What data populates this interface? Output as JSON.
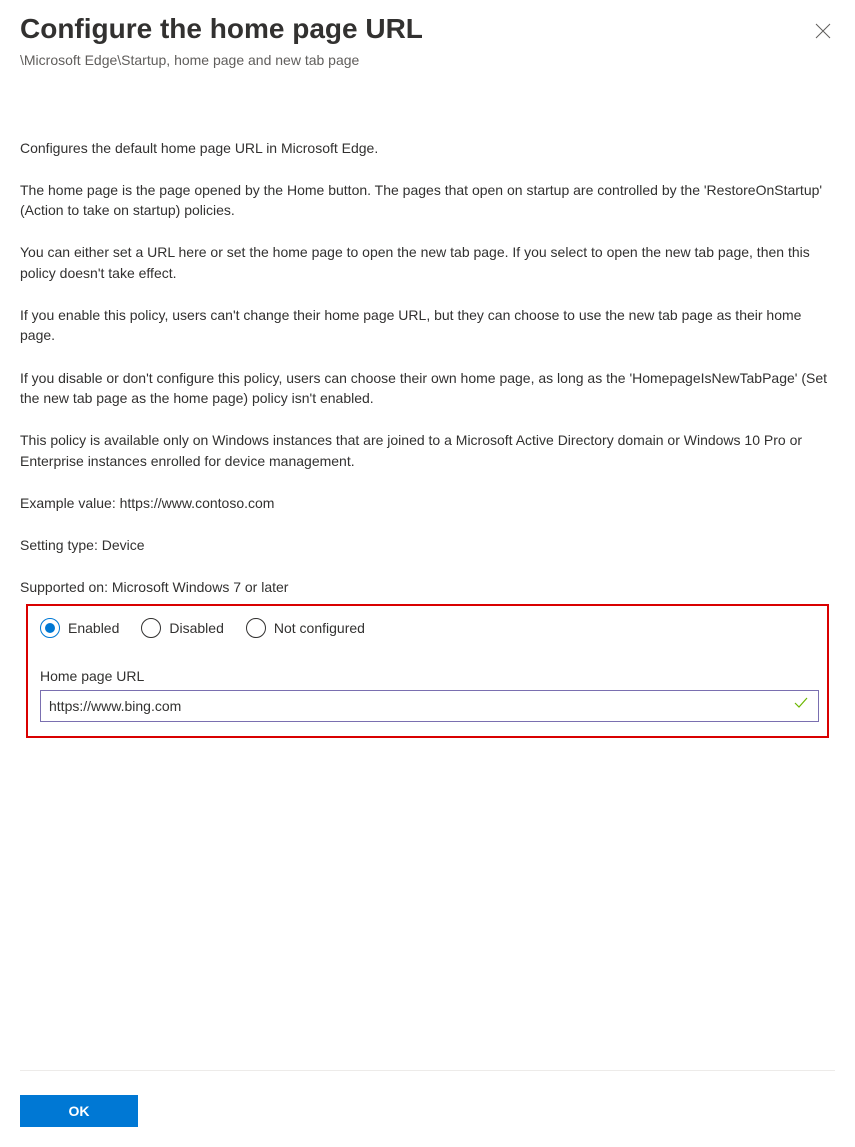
{
  "header": {
    "title": "Configure the home page URL",
    "breadcrumb": "\\Microsoft Edge\\Startup, home page and new tab page"
  },
  "description": {
    "p1": "Configures the default home page URL in Microsoft Edge.",
    "p2": "The home page is the page opened by the Home button. The pages that open on startup are controlled by the 'RestoreOnStartup' (Action to take on startup) policies.",
    "p3": "You can either set a URL here or set the home page to open the new tab page. If you select to open the new tab page, then this policy doesn't take effect.",
    "p4": "If you enable this policy, users can't change their home page URL, but they can choose to use the new tab page as their home page.",
    "p5": "If you disable or don't configure this policy, users can choose their own home page, as long as the 'HomepageIsNewTabPage' (Set the new tab page as the home page) policy isn't enabled.",
    "p6": "This policy is available only on Windows instances that are joined to a Microsoft Active Directory domain or Windows 10 Pro or Enterprise instances enrolled for device management.",
    "example": "Example value: https://www.contoso.com",
    "setting_type": "Setting type: Device",
    "supported_on": "Supported on: Microsoft Windows 7 or later"
  },
  "form": {
    "radio": {
      "enabled": "Enabled",
      "disabled": "Disabled",
      "not_configured": "Not configured",
      "selected": "enabled"
    },
    "home_url": {
      "label": "Home page URL",
      "value": "https://www.bing.com"
    }
  },
  "footer": {
    "ok": "OK"
  }
}
